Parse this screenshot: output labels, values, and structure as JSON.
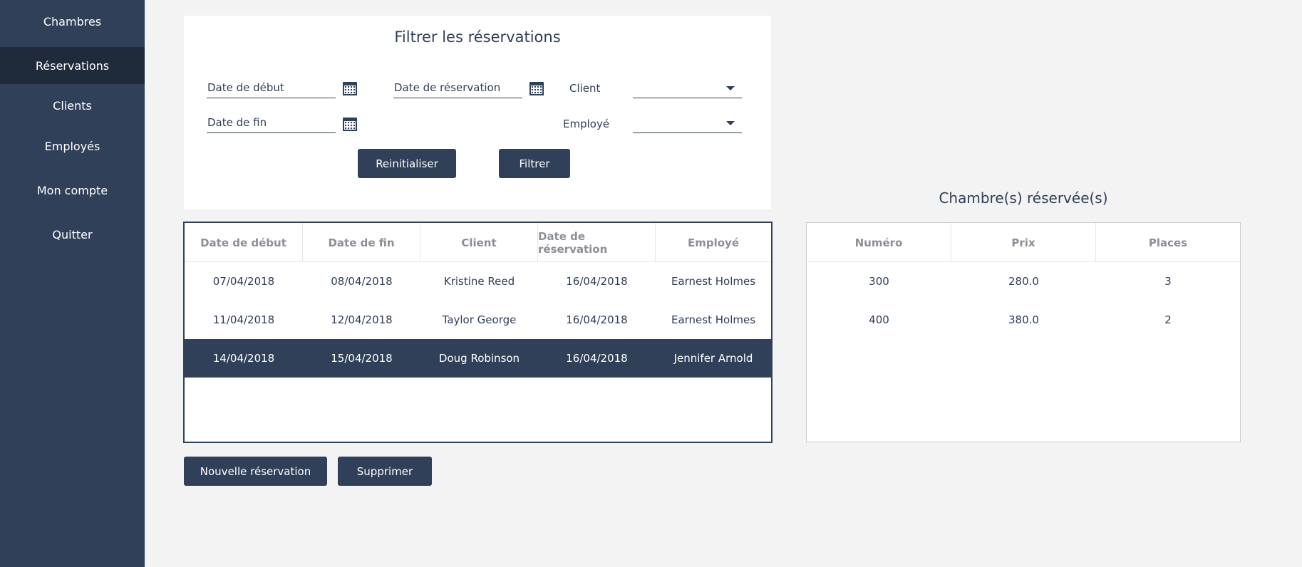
{
  "sidebar": {
    "items": [
      {
        "label": "Chambres"
      },
      {
        "label": "Réservations"
      },
      {
        "label": "Clients"
      },
      {
        "label": "Employés"
      },
      {
        "label": "Mon compte"
      },
      {
        "label": "Quitter"
      }
    ],
    "active_index": 1
  },
  "filter": {
    "title": "Filtrer les réservations",
    "start_date_placeholder": "Date de début",
    "reservation_date_placeholder": "Date de réservation",
    "end_date_placeholder": "Date de fin",
    "client_label": "Client",
    "client_value": "",
    "employee_label": "Employé",
    "employee_value": "",
    "reset_label": "Reinitialiser",
    "filter_label": "Filtrer"
  },
  "reservations": {
    "columns": [
      "Date de début",
      "Date de fin",
      "Client",
      "Date de réservation",
      "Employé"
    ],
    "rows": [
      [
        "07/04/2018",
        "08/04/2018",
        "Kristine Reed",
        "16/04/2018",
        "Earnest Holmes"
      ],
      [
        "11/04/2018",
        "12/04/2018",
        "Taylor George",
        "16/04/2018",
        "Earnest Holmes"
      ],
      [
        "14/04/2018",
        "15/04/2018",
        "Doug Robinson",
        "16/04/2018",
        "Jennifer Arnold"
      ]
    ],
    "selected_row": 2
  },
  "actions": {
    "new_label": "Nouvelle réservation",
    "delete_label": "Supprimer"
  },
  "rooms": {
    "title": "Chambre(s) réservée(s)",
    "columns": [
      "Numéro",
      "Prix",
      "Places"
    ],
    "rows": [
      [
        "300",
        "280.0",
        "3"
      ],
      [
        "400",
        "380.0",
        "2"
      ]
    ]
  },
  "colors": {
    "primary": "#314059",
    "sidebar_active": "#1f2a3b",
    "background": "#f3f3f3"
  },
  "icons": {
    "date_picker": "calendar-icon",
    "combo": "chevron-down-icon"
  }
}
